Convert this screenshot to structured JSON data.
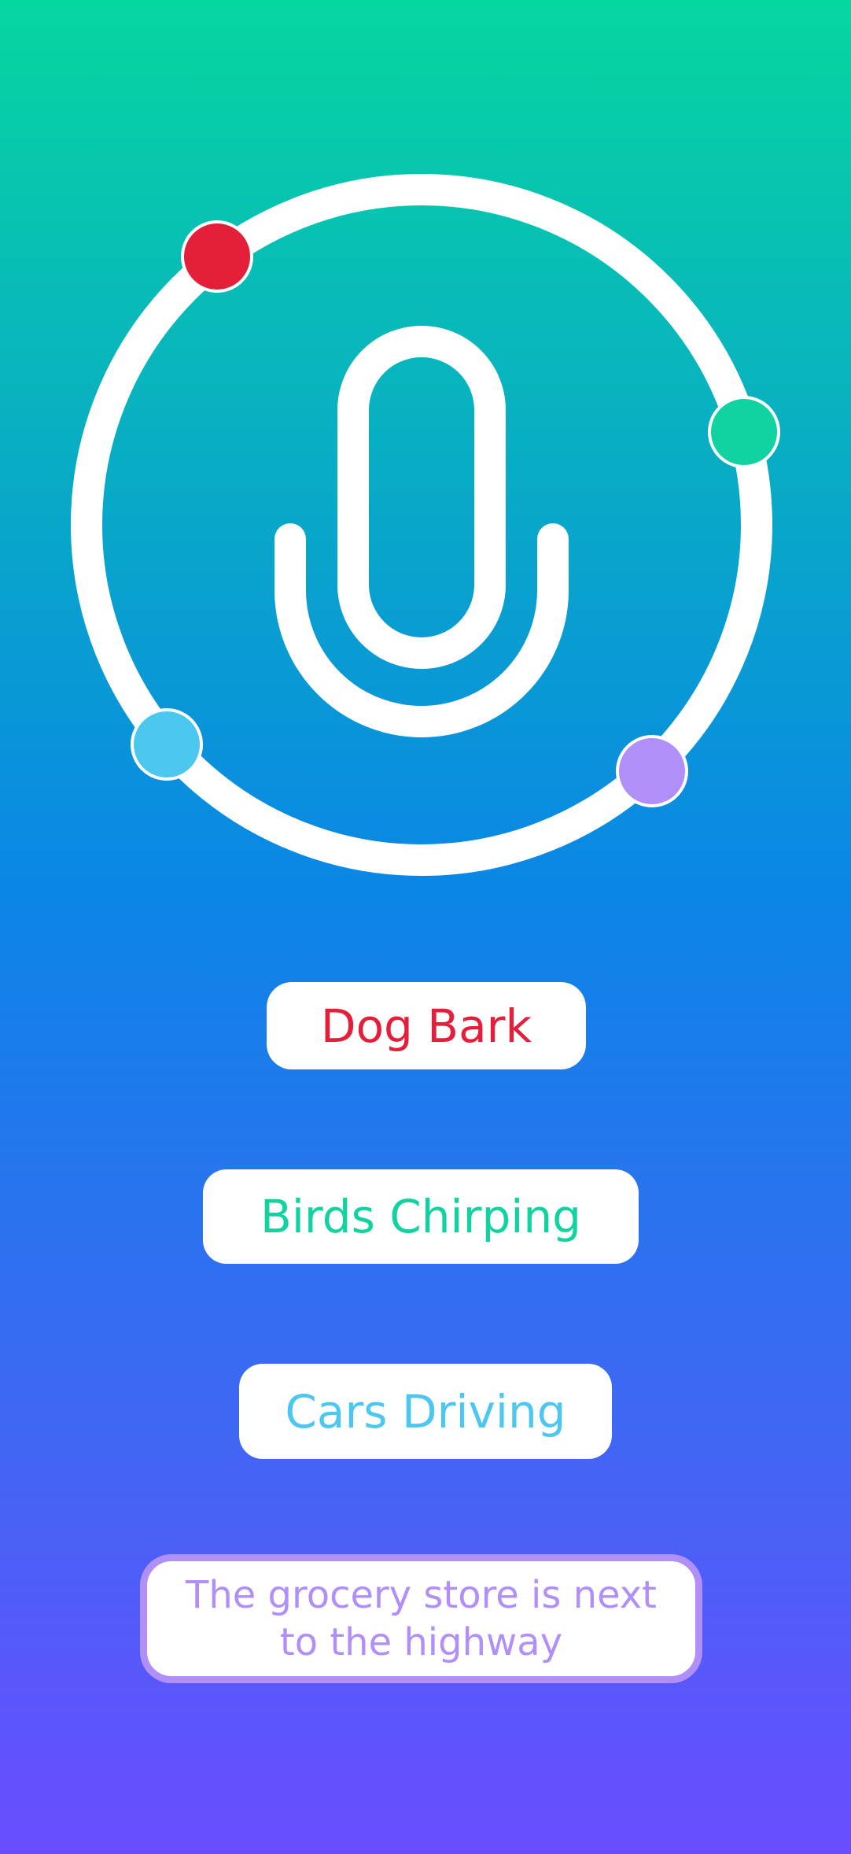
{
  "colors": {
    "gradient_top": "#06d6a0",
    "gradient_mid": "#0a86e6",
    "gradient_bottom": "#6a4dff",
    "red": "#e51f3a",
    "green": "#10d3a1",
    "blue": "#4cc7ef",
    "purple": "#b18ff9"
  },
  "icons": {
    "mic": "microphone-icon",
    "orbit": "orbit-ring"
  },
  "sounds": [
    {
      "label": "Dog Bark"
    },
    {
      "label": "Birds Chirping"
    },
    {
      "label": "Cars Driving"
    }
  ],
  "phrase": {
    "line1": "The grocery store is next",
    "line2": "to the highway"
  }
}
